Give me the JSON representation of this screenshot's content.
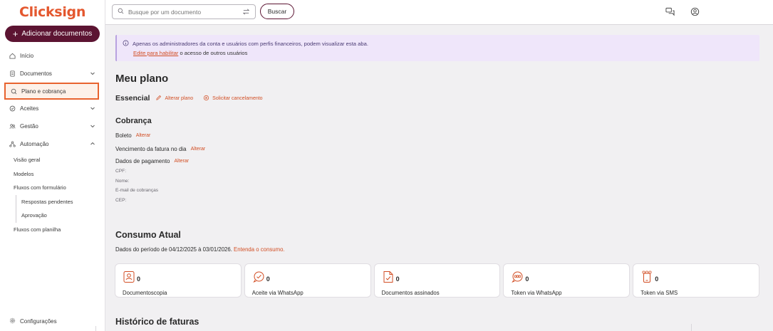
{
  "app": {
    "logo_text": "Clicksign",
    "accent": "#e4572e",
    "brand": "#5c1432"
  },
  "sidebar": {
    "add_button": "Adicionar documentos",
    "items": [
      {
        "label": "Início",
        "icon": "home-icon"
      },
      {
        "label": "Documentos",
        "icon": "document-icon"
      },
      {
        "label": "Plano e cobrança",
        "icon": "billing-icon",
        "active": true
      },
      {
        "label": "Aceites",
        "icon": "check-circle-icon"
      },
      {
        "label": "Gestão",
        "icon": "people-icon"
      },
      {
        "label": "Automação",
        "icon": "automation-icon"
      }
    ],
    "automacao_sub": [
      "Visão geral",
      "Modelos",
      "Fluxos com formulário",
      "Respostas pendentes",
      "Aprovação",
      "Fluxos com planilha"
    ],
    "config": "Configurações"
  },
  "topbar": {
    "search_placeholder": "Busque por um documento",
    "search_button": "Buscar"
  },
  "info": {
    "message": "Apenas os administradores da conta e usuários com perfis financeiros, podem visualizar esta aba.",
    "link": "Edite para habilitar",
    "link_suffix": "o acesso de outros usuários"
  },
  "plano": {
    "title": "Meu plano",
    "plan_name": "Essencial",
    "change_plan": "Alterar plano",
    "cancel": "Solicitar cancelamento"
  },
  "cobranca": {
    "title": "Cobrança",
    "boleto": "Boleto",
    "alterar": "Alterar",
    "vencimento": "Vencimento da fatura no dia",
    "dados_pagamento": "Dados de pagamento",
    "cpf": "CPF:",
    "nome": "Nome:",
    "email": "E-mail de cobranças",
    "cep": "CEP:"
  },
  "consumo": {
    "title": "Consumo Atual",
    "periodo": "Dados do período de 04/12/2025 à 03/01/2026.",
    "periodo_link": "Entenda o consumo.",
    "cards": [
      {
        "value": "0",
        "label": "Documentoscopia",
        "icon": "face-scan-icon"
      },
      {
        "value": "0",
        "label": "Aceite via WhatsApp",
        "icon": "whatsapp-check-icon"
      },
      {
        "value": "0",
        "label": "Documentos assinados",
        "icon": "signed-document-icon"
      },
      {
        "value": "0",
        "label": "Token via WhatsApp",
        "icon": "whatsapp-token-icon"
      },
      {
        "value": "0",
        "label": "Token via SMS",
        "icon": "sms-token-icon"
      }
    ]
  },
  "historico": {
    "title": "Histórico de faturas"
  }
}
